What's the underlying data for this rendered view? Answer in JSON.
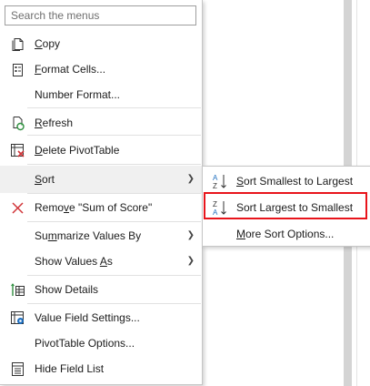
{
  "search": {
    "placeholder": "Search the menus"
  },
  "menu": {
    "copy": {
      "label": "Copy",
      "hotkey": "C"
    },
    "format_cells": {
      "label": "Format Cells...",
      "hotkey": "F"
    },
    "number_format": {
      "label": "Number Format..."
    },
    "refresh": {
      "label": "Refresh",
      "hotkey": "R"
    },
    "delete_pivot": {
      "label": "Delete PivotTable",
      "hotkey": "D"
    },
    "sort": {
      "label": "Sort",
      "hotkey": "S"
    },
    "remove": {
      "label": "Remove \"Sum of Score\"",
      "hotkey": "v"
    },
    "summarize": {
      "label": "Summarize Values By",
      "hotkey": "m"
    },
    "show_values": {
      "label": "Show Values As",
      "hotkey": "A"
    },
    "show_details": {
      "label": "Show Details",
      "hotkey": "E"
    },
    "value_field": {
      "label": "Value Field Settings...",
      "hotkey": "N"
    },
    "pivot_options": {
      "label": "PivotTable Options..."
    },
    "hide_field": {
      "label": "Hide Field List"
    }
  },
  "submenu": {
    "sort_asc": {
      "label": "Sort Smallest to Largest",
      "hotkey": "S"
    },
    "sort_desc": {
      "label": "Sort Largest to Smallest",
      "hotkey": "O"
    },
    "more": {
      "label": "More Sort Options...",
      "hotkey": "M"
    }
  },
  "colors": {
    "highlight_border": "#e8141b",
    "hover_bg": "#f0f0f0",
    "accent_blue": "#1f6fbf"
  }
}
